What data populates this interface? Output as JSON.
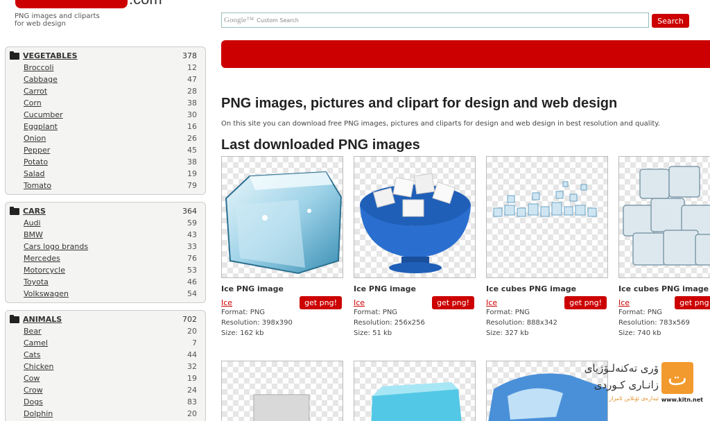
{
  "header": {
    "logo_suffix": ".com",
    "tagline": "PNG images and cliparts\nfor web design",
    "search_brand": "Google™",
    "search_placeholder": "Custom Search",
    "search_button": "Search"
  },
  "sidebar": {
    "categories": [
      {
        "name": "VEGETABLES",
        "count": "378",
        "items": [
          {
            "label": "Broccoli",
            "count": "12"
          },
          {
            "label": "Cabbage",
            "count": "47"
          },
          {
            "label": "Carrot",
            "count": "28"
          },
          {
            "label": "Corn",
            "count": "38"
          },
          {
            "label": "Cucumber",
            "count": "30"
          },
          {
            "label": "Eggplant",
            "count": "16"
          },
          {
            "label": "Onion",
            "count": "26"
          },
          {
            "label": "Pepper",
            "count": "45"
          },
          {
            "label": "Potato",
            "count": "38"
          },
          {
            "label": "Salad",
            "count": "19"
          },
          {
            "label": "Tomato",
            "count": "79"
          }
        ]
      },
      {
        "name": "CARS",
        "count": "364",
        "items": [
          {
            "label": "Audi",
            "count": "59"
          },
          {
            "label": "BMW",
            "count": "43"
          },
          {
            "label": "Cars logo brands",
            "count": "33"
          },
          {
            "label": "Mercedes",
            "count": "76"
          },
          {
            "label": "Motorcycle",
            "count": "53"
          },
          {
            "label": "Toyota",
            "count": "46"
          },
          {
            "label": "Volkswagen",
            "count": "54"
          }
        ]
      },
      {
        "name": "ANIMALS",
        "count": "702",
        "items": [
          {
            "label": "Bear",
            "count": "20"
          },
          {
            "label": "Camel",
            "count": "7"
          },
          {
            "label": "Cats",
            "count": "44"
          },
          {
            "label": "Chicken",
            "count": "32"
          },
          {
            "label": "Cow",
            "count": "19"
          },
          {
            "label": "Crow",
            "count": "24"
          },
          {
            "label": "Dogs",
            "count": "83"
          },
          {
            "label": "Dolphin",
            "count": "20"
          }
        ]
      }
    ]
  },
  "main": {
    "title": "PNG images, pictures and clipart for design and web design",
    "description": "On this site you can download free PNG images, pictures and cliparts for design and web design in best resolution and quality.",
    "section_title": "Last downloaded PNG images",
    "cards": [
      {
        "title": "Ice PNG image",
        "link": "Ice",
        "button": "get png!",
        "format": "Format: PNG",
        "resolution": "Resolution: 398x390",
        "size": "Size: 162 kb",
        "icon": "ice-cube-icon"
      },
      {
        "title": "Ice PNG image",
        "link": "Ice",
        "button": "get png!",
        "format": "Format: PNG",
        "resolution": "Resolution: 256x256",
        "size": "Size: 51 kb",
        "icon": "ice-bowl-icon"
      },
      {
        "title": "Ice cubes PNG image",
        "link": "Ice",
        "button": "get png!",
        "format": "Format: PNG",
        "resolution": "Resolution: 888x342",
        "size": "Size: 327 kb",
        "icon": "ice-cubes-row-icon"
      },
      {
        "title": "Ice cubes PNG image",
        "link": "Ice",
        "button": "get png!",
        "format": "Format: PNG",
        "resolution": "Resolution: 783x569",
        "size": "Size: 740 kb",
        "icon": "ice-cubes-pile-icon"
      }
    ]
  },
  "watermark": {
    "line1": "ۆری تەکنەلـۆژیای",
    "line2": "زانـاری کـوردی",
    "sub": "ئیدارەی ئۆنلاین ئامراز",
    "logo_glyph": "ت",
    "url": "www.kitn.net"
  },
  "colors": {
    "accent": "#cc0000",
    "watermark": "#f29a2e"
  }
}
